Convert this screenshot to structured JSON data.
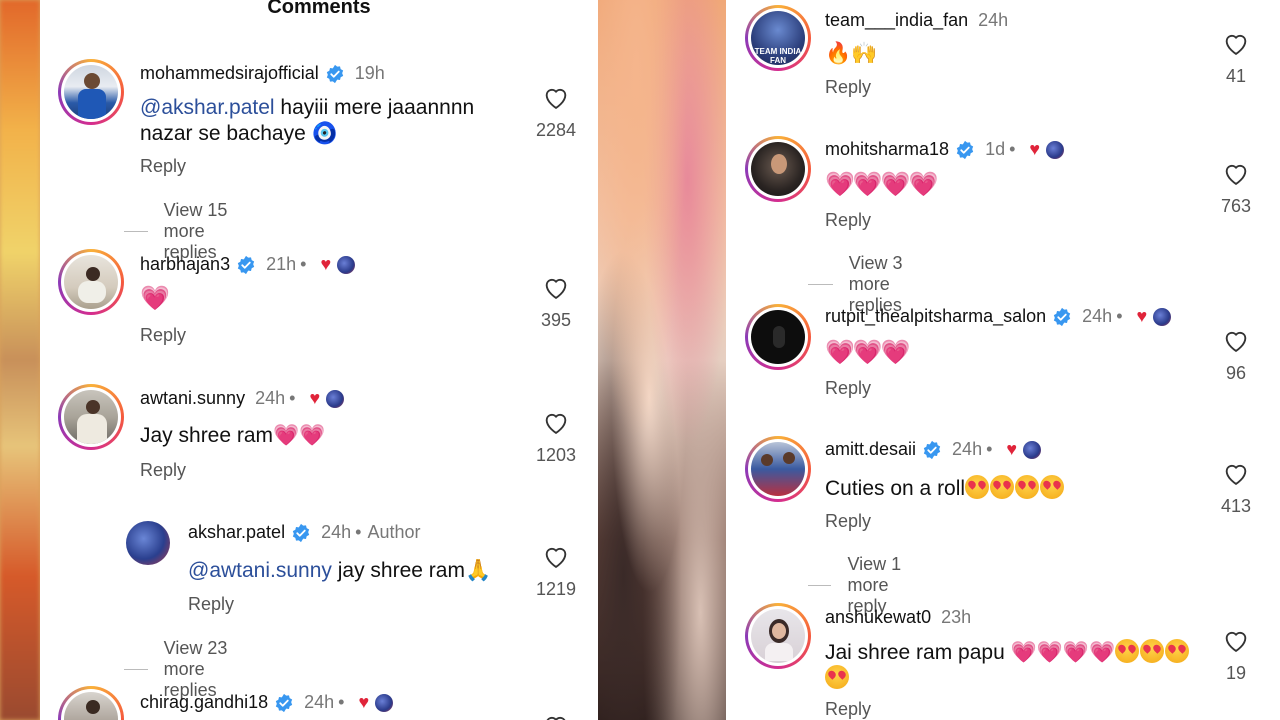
{
  "title": "Comments",
  "left_comments": [
    {
      "user": "mohammedsirajofficial",
      "verified": true,
      "time": "19h",
      "mention": "@akshar.patel",
      "text_line1": " hayiii mere jaaannnn",
      "text_line2": "nazar se bachaye 🧿",
      "reply": "Reply",
      "likes": "2284",
      "more": "View 15 more replies"
    },
    {
      "user": "harbhajan3",
      "verified": true,
      "time": "21h",
      "creator_liked": true,
      "text": "💗",
      "reply": "Reply",
      "likes": "395"
    },
    {
      "user": "awtani.sunny",
      "verified": false,
      "time": "24h",
      "creator_liked": true,
      "text": "Jay shree ram💗💗",
      "reply": "Reply",
      "likes": "1203"
    },
    {
      "user": "akshar.patel",
      "verified": true,
      "time": "24h",
      "author_label": "Author",
      "mention": "@awtani.sunny",
      "text": " jay shree ram🙏",
      "reply": "Reply",
      "likes": "1219",
      "more": "View 23 more replies"
    },
    {
      "user": "chirag.gandhi18",
      "verified": true,
      "time": "24h",
      "creator_liked": true
    }
  ],
  "right_comments": [
    {
      "user": "team___india_fan",
      "time": "24h",
      "text": "🔥🙌",
      "reply": "Reply",
      "likes": "41"
    },
    {
      "user": "mohitsharma18",
      "verified": true,
      "time": "1d",
      "creator_liked": true,
      "text": "💗💗💗💗",
      "reply": "Reply",
      "likes": "763",
      "more": "View 3 more replies"
    },
    {
      "user": "rutpit_thealpitsharma_salon",
      "verified": true,
      "time": "24h",
      "creator_liked": true,
      "text": "💗💗💗",
      "reply": "Reply",
      "likes": "96"
    },
    {
      "user": "amitt.desaii",
      "verified": true,
      "time": "24h",
      "creator_liked": true,
      "text": "Cuties on a roll",
      "emoji_count": 4,
      "reply": "Reply",
      "likes": "413",
      "more": "View 1 more reply"
    },
    {
      "user": "anshukewat0",
      "time": "23h",
      "text": "Jai shree ram papu 💗💗💗💗",
      "emoji_count_line1": 3,
      "emoji_count_line2": 1,
      "reply": "Reply",
      "likes": "19"
    }
  ],
  "icons": {
    "verified": "verified-badge-icon",
    "like": "heart-outline-icon",
    "creator_like": "red-heart-icon"
  },
  "colors": {
    "verified_blue": "#3897f0",
    "mention": "#2c4f9a",
    "creator_heart": "#e0243a"
  }
}
